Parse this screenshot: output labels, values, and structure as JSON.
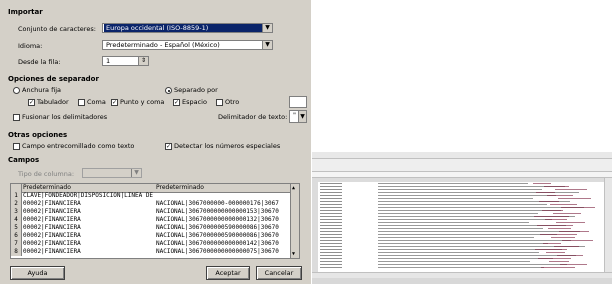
{
  "dialog": {
    "import_heading": "Importar",
    "charset_label": "Conjunto de caracteres:",
    "charset_value": "Europa occidental (ISO-8859-1)",
    "language_label": "Idioma:",
    "language_value": "Predeterminado - Español (México)",
    "from_row_label": "Desde la fila:",
    "from_row_value": "1",
    "separator_heading": "Opciones de separador",
    "fixed_width_label": "Anchura fija",
    "separated_by_label": "Separado por",
    "tab_label": "Tabulador",
    "comma_label": "Coma",
    "semicolon_label": "Punto y coma",
    "space_label": "Espacio",
    "other_label": "Otro",
    "merge_label": "Fusionar los delimitadores",
    "text_delim_label": "Delimitador de texto:",
    "text_delim_value": "\"",
    "other_heading": "Otras opciones",
    "quoted_label": "Campo entrecomillado como texto",
    "detect_label": "Detectar los números especiales",
    "fields_heading": "Campos",
    "col_type_label": "Tipo de columna:",
    "help_button": "Ayuda",
    "ok_button": "Aceptar",
    "cancel_button": "Cancelar"
  },
  "preview": {
    "headers": [
      "Predeterminado",
      "Predeterminado"
    ],
    "rows": [
      {
        "n": "1",
        "c1": "CLAVE|FONDEADOR|DISPOSICION|LINEA DE",
        "c2": ""
      },
      {
        "n": "2",
        "c1": "00002|FINANCIERA",
        "c2": "NACIONAL|3067000000-000000176|3067"
      },
      {
        "n": "3",
        "c1": "00002|FINANCIERA",
        "c2": "NACIONAL|3067000000000000153|30670"
      },
      {
        "n": "4",
        "c1": "00002|FINANCIERA",
        "c2": "NACIONAL|3067000000000000132|30670"
      },
      {
        "n": "5",
        "c1": "00002|FINANCIERA",
        "c2": "NACIONAL|3067000000590000086|30670"
      },
      {
        "n": "6",
        "c1": "00002|FINANCIERA",
        "c2": "NACIONAL|3067000000590000086|30670"
      },
      {
        "n": "7",
        "c1": "00002|FINANCIERA",
        "c2": "NACIONAL|3067000000000000142|30670"
      },
      {
        "n": "8",
        "c1": "00002|FINANCIERA",
        "c2": "NACIONAL|3067000000000000075|30670"
      }
    ]
  },
  "colors": {
    "dialog_bg": "#d4d0c8",
    "selection": "#0a246a",
    "sheet_text": "#333333",
    "sheet_link": "#7a1e3c"
  }
}
